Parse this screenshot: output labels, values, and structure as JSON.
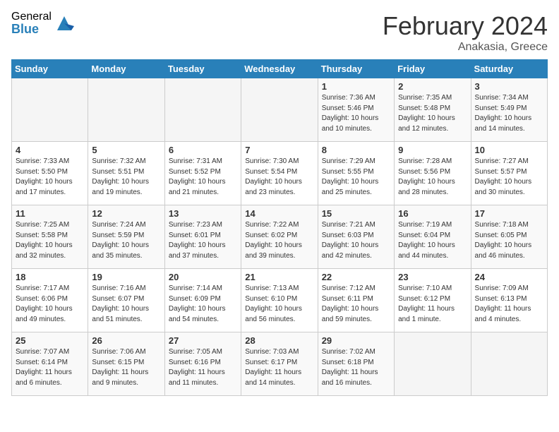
{
  "logo": {
    "general": "General",
    "blue": "Blue"
  },
  "header": {
    "month": "February 2024",
    "location": "Anakasia, Greece"
  },
  "days_of_week": [
    "Sunday",
    "Monday",
    "Tuesday",
    "Wednesday",
    "Thursday",
    "Friday",
    "Saturday"
  ],
  "weeks": [
    [
      {
        "day": "",
        "info": ""
      },
      {
        "day": "",
        "info": ""
      },
      {
        "day": "",
        "info": ""
      },
      {
        "day": "",
        "info": ""
      },
      {
        "day": "1",
        "info": "Sunrise: 7:36 AM\nSunset: 5:46 PM\nDaylight: 10 hours\nand 10 minutes."
      },
      {
        "day": "2",
        "info": "Sunrise: 7:35 AM\nSunset: 5:48 PM\nDaylight: 10 hours\nand 12 minutes."
      },
      {
        "day": "3",
        "info": "Sunrise: 7:34 AM\nSunset: 5:49 PM\nDaylight: 10 hours\nand 14 minutes."
      }
    ],
    [
      {
        "day": "4",
        "info": "Sunrise: 7:33 AM\nSunset: 5:50 PM\nDaylight: 10 hours\nand 17 minutes."
      },
      {
        "day": "5",
        "info": "Sunrise: 7:32 AM\nSunset: 5:51 PM\nDaylight: 10 hours\nand 19 minutes."
      },
      {
        "day": "6",
        "info": "Sunrise: 7:31 AM\nSunset: 5:52 PM\nDaylight: 10 hours\nand 21 minutes."
      },
      {
        "day": "7",
        "info": "Sunrise: 7:30 AM\nSunset: 5:54 PM\nDaylight: 10 hours\nand 23 minutes."
      },
      {
        "day": "8",
        "info": "Sunrise: 7:29 AM\nSunset: 5:55 PM\nDaylight: 10 hours\nand 25 minutes."
      },
      {
        "day": "9",
        "info": "Sunrise: 7:28 AM\nSunset: 5:56 PM\nDaylight: 10 hours\nand 28 minutes."
      },
      {
        "day": "10",
        "info": "Sunrise: 7:27 AM\nSunset: 5:57 PM\nDaylight: 10 hours\nand 30 minutes."
      }
    ],
    [
      {
        "day": "11",
        "info": "Sunrise: 7:25 AM\nSunset: 5:58 PM\nDaylight: 10 hours\nand 32 minutes."
      },
      {
        "day": "12",
        "info": "Sunrise: 7:24 AM\nSunset: 5:59 PM\nDaylight: 10 hours\nand 35 minutes."
      },
      {
        "day": "13",
        "info": "Sunrise: 7:23 AM\nSunset: 6:01 PM\nDaylight: 10 hours\nand 37 minutes."
      },
      {
        "day": "14",
        "info": "Sunrise: 7:22 AM\nSunset: 6:02 PM\nDaylight: 10 hours\nand 39 minutes."
      },
      {
        "day": "15",
        "info": "Sunrise: 7:21 AM\nSunset: 6:03 PM\nDaylight: 10 hours\nand 42 minutes."
      },
      {
        "day": "16",
        "info": "Sunrise: 7:19 AM\nSunset: 6:04 PM\nDaylight: 10 hours\nand 44 minutes."
      },
      {
        "day": "17",
        "info": "Sunrise: 7:18 AM\nSunset: 6:05 PM\nDaylight: 10 hours\nand 46 minutes."
      }
    ],
    [
      {
        "day": "18",
        "info": "Sunrise: 7:17 AM\nSunset: 6:06 PM\nDaylight: 10 hours\nand 49 minutes."
      },
      {
        "day": "19",
        "info": "Sunrise: 7:16 AM\nSunset: 6:07 PM\nDaylight: 10 hours\nand 51 minutes."
      },
      {
        "day": "20",
        "info": "Sunrise: 7:14 AM\nSunset: 6:09 PM\nDaylight: 10 hours\nand 54 minutes."
      },
      {
        "day": "21",
        "info": "Sunrise: 7:13 AM\nSunset: 6:10 PM\nDaylight: 10 hours\nand 56 minutes."
      },
      {
        "day": "22",
        "info": "Sunrise: 7:12 AM\nSunset: 6:11 PM\nDaylight: 10 hours\nand 59 minutes."
      },
      {
        "day": "23",
        "info": "Sunrise: 7:10 AM\nSunset: 6:12 PM\nDaylight: 11 hours\nand 1 minute."
      },
      {
        "day": "24",
        "info": "Sunrise: 7:09 AM\nSunset: 6:13 PM\nDaylight: 11 hours\nand 4 minutes."
      }
    ],
    [
      {
        "day": "25",
        "info": "Sunrise: 7:07 AM\nSunset: 6:14 PM\nDaylight: 11 hours\nand 6 minutes."
      },
      {
        "day": "26",
        "info": "Sunrise: 7:06 AM\nSunset: 6:15 PM\nDaylight: 11 hours\nand 9 minutes."
      },
      {
        "day": "27",
        "info": "Sunrise: 7:05 AM\nSunset: 6:16 PM\nDaylight: 11 hours\nand 11 minutes."
      },
      {
        "day": "28",
        "info": "Sunrise: 7:03 AM\nSunset: 6:17 PM\nDaylight: 11 hours\nand 14 minutes."
      },
      {
        "day": "29",
        "info": "Sunrise: 7:02 AM\nSunset: 6:18 PM\nDaylight: 11 hours\nand 16 minutes."
      },
      {
        "day": "",
        "info": ""
      },
      {
        "day": "",
        "info": ""
      }
    ]
  ]
}
